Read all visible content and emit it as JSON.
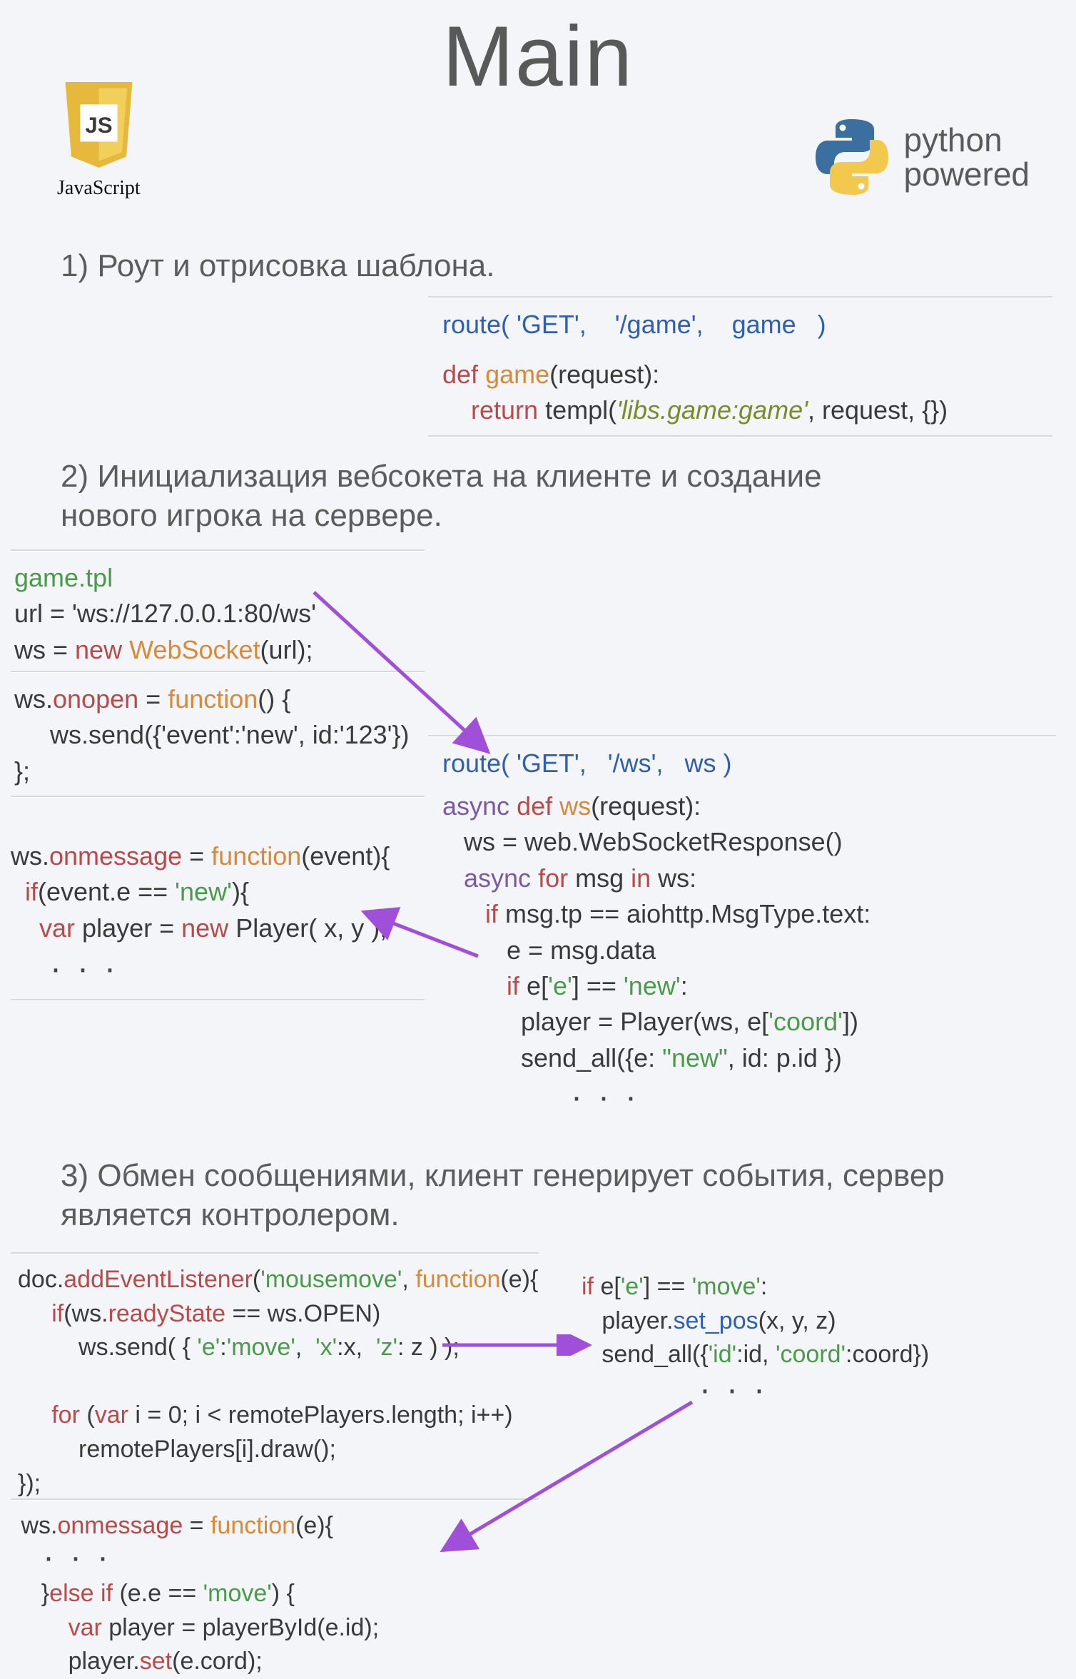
{
  "title": "Main",
  "logos": {
    "js_label": "JavaScript",
    "py_label_line1": "python",
    "py_label_line2": "powered"
  },
  "sections": {
    "s1": "1) Роут и отрисовка шаблона.",
    "s2": "2) Инициализация вебсокета на клиенте и создание нового игрока на сервере.",
    "s3": "3) Обмен сообщениями, клиент генерирует события, сервер является контролером."
  },
  "code": {
    "route_game": "route( 'GET',    '/game',    game   )",
    "def_game_1": "def game(request):",
    "def_game_2": "    return templ('libs.game:game', request, {})",
    "game_tpl": "game.tpl",
    "js_url": "url = 'ws://127.0.0.1:80/ws'",
    "js_ws_new": "ws = new WebSocket(url);",
    "js_onopen_1": "ws.onopen = function() {",
    "js_onopen_2": "     ws.send({'event':'new', id:'123'})",
    "js_onopen_3": "};",
    "js_onmsg_1": "ws.onmessage = function(event){",
    "js_onmsg_2": "  if(event.e == 'new'){",
    "js_onmsg_3": "    var player = new Player( x, y );",
    "route_ws": "route( 'GET',   '/ws',   ws )",
    "py_async_1": "async def ws(request):",
    "py_async_2": "   ws = web.WebSocketResponse()",
    "py_async_3": "   async for msg in ws:",
    "py_async_4": "      if msg.tp == aiohttp.MsgType.text:",
    "py_async_5": "         e = msg.data",
    "py_async_6": "         if e['e'] == 'new':",
    "py_async_7": "           player = Player(ws, e['coord'])",
    "py_async_8": "           send_all({e: \"new\", id: p.id })",
    "js3_1": "doc.addEventListener('mousemove', function(e){",
    "js3_2": "     if(ws.readyState == ws.OPEN)",
    "js3_3": "         ws.send( { 'e':'move',  'x':x,  'z': z ) );",
    "js3_4": "     for (var i = 0; i < remotePlayers.length; i++)",
    "js3_5": "         remotePlayers[i].draw();",
    "js3_6": "});",
    "py3_1": "if e['e'] == 'move':",
    "py3_2": "   player.set_pos(x, y, z)",
    "py3_3": "   send_all({'id':id, 'coord':coord})",
    "js4_1": " ws.onmessage = function(e){",
    "js4_2": "    }else if (e.e == 'move') {",
    "js4_3": "        var player = playerById(e.id);",
    "js4_4": "        player.set(e.cord);"
  }
}
